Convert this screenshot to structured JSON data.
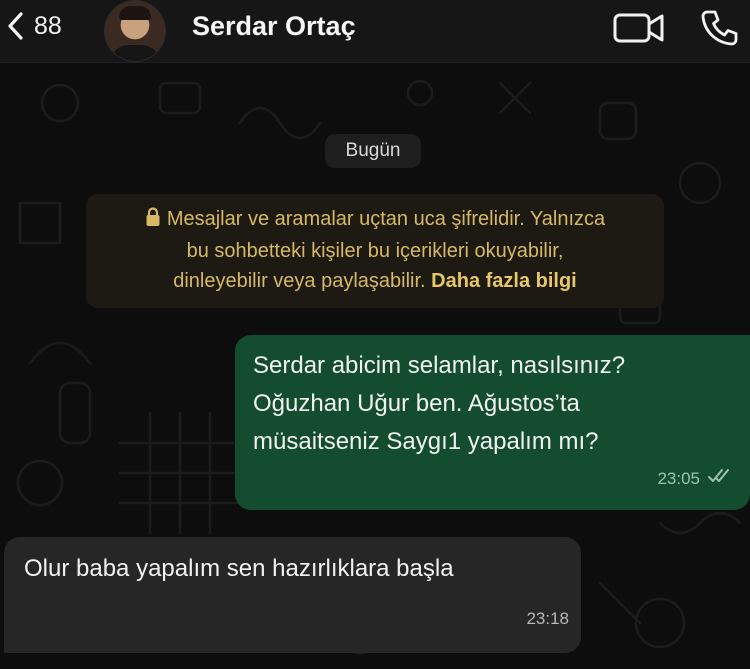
{
  "header": {
    "back_count": "88",
    "contact_name": "Serdar Ortaç",
    "icons": [
      "back-chevron-icon",
      "video-call-icon",
      "phone-call-icon"
    ]
  },
  "chat": {
    "date_label": "Bugün",
    "encryption_notice": {
      "line1": "Mesajlar ve aramalar uçtan uca şifrelidir. Yalnızca",
      "line2": "bu sohbetteki kişiler bu içerikleri okuyabilir,",
      "line3": "dinleyebilir veya paylaşabilir.",
      "link": "Daha fazla bilgi",
      "icon": "lock-icon"
    },
    "messages": [
      {
        "direction": "outgoing",
        "lines": [
          "Serdar abicim selamlar, nasılsınız?",
          "Oğuzhan Uğur ben. Ağustos’ta",
          "müsaitseniz Saygı1 yapalım mı?"
        ],
        "time": "23:05",
        "status_icon": "double-check-icon"
      },
      {
        "direction": "incoming",
        "lines": [
          "Olur baba yapalım sen hazırlıklara başla"
        ],
        "time": "23:18"
      }
    ]
  },
  "colors": {
    "header_bg": "#161616",
    "chat_bg": "#0d0d0d",
    "outgoing_bubble": "#144c2f",
    "incoming_bubble": "#262626",
    "encryption_text": "#d7b864"
  }
}
